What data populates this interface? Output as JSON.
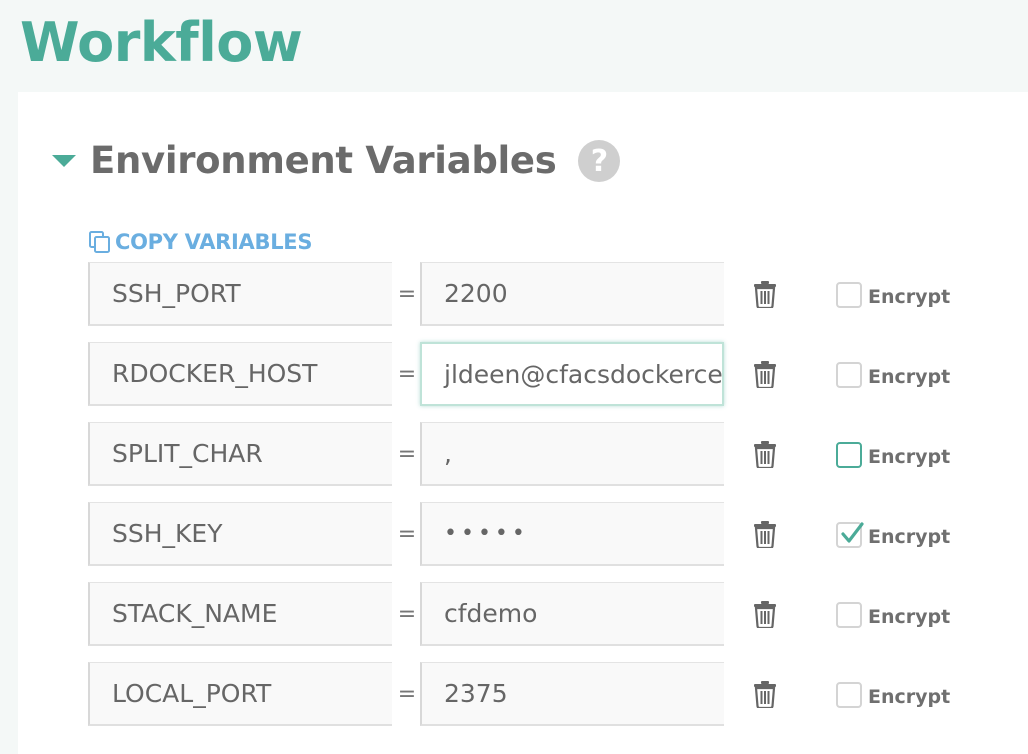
{
  "page": {
    "title": "Workflow"
  },
  "section": {
    "title": "Environment Variables",
    "help_glyph": "?"
  },
  "copy_variables": {
    "label": "COPY VARIABLES"
  },
  "colors": {
    "accent": "#4bab98",
    "link": "#6aaee0",
    "text": "#666666"
  },
  "variables": [
    {
      "name": "SSH_PORT",
      "equals": "=",
      "value": "2200",
      "encrypt_label": "Encrypt",
      "encrypted": false
    },
    {
      "name": "RDOCKER_HOST",
      "equals": "=",
      "value": "jldeen@cfacsdockerce",
      "encrypt_label": "Encrypt",
      "encrypted": false
    },
    {
      "name": "SPLIT_CHAR",
      "equals": "=",
      "value": ",",
      "encrypt_label": "Encrypt",
      "encrypted": false
    },
    {
      "name": "SSH_KEY",
      "equals": "=",
      "value": "•••••",
      "encrypt_label": "Encrypt",
      "encrypted": true
    },
    {
      "name": "STACK_NAME",
      "equals": "=",
      "value": "cfdemo",
      "encrypt_label": "Encrypt",
      "encrypted": false
    },
    {
      "name": "LOCAL_PORT",
      "equals": "=",
      "value": "2375",
      "encrypt_label": "Encrypt",
      "encrypted": false
    }
  ]
}
